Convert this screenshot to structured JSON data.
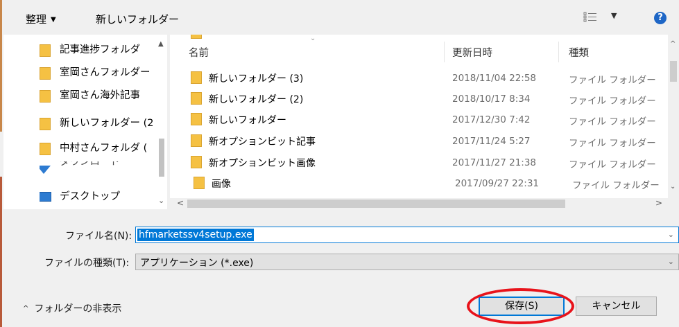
{
  "toolbar": {
    "organize_label": "整理",
    "new_folder_label": "新しいフォルダー",
    "help_label": "?"
  },
  "nav": {
    "items": [
      {
        "label": "記事進捗フォルダ",
        "icon": "folder-icon"
      },
      {
        "label": "室岡さんフォルダー",
        "icon": "folder-icon"
      },
      {
        "label": "室岡さん海外記事",
        "icon": "folder-icon"
      },
      {
        "label": "新しいフォルダー (2",
        "icon": "folder-icon"
      },
      {
        "label": "中村さんフォルダ (",
        "icon": "folder-icon"
      },
      {
        "label": "ダウンロード",
        "icon": "download-icon"
      },
      {
        "label": "デスクトップ",
        "icon": "desktop-icon"
      }
    ]
  },
  "columns": {
    "name": "名前",
    "date": "更新日時",
    "type": "種類"
  },
  "files": [
    {
      "name": "新しいフォルダー (3)",
      "date": "2018/11/04 22:58",
      "type": "ファイル フォルダー"
    },
    {
      "name": "新しいフォルダー (2)",
      "date": "2018/10/17 8:34",
      "type": "ファイル フォルダー"
    },
    {
      "name": "新しいフォルダー",
      "date": "2017/12/30 7:42",
      "type": "ファイル フォルダー"
    },
    {
      "name": "新オプションビット記事",
      "date": "2017/11/24 5:27",
      "type": "ファイル フォルダー"
    },
    {
      "name": "新オプションビット画像",
      "date": "2017/11/27 21:38",
      "type": "ファイル フォルダー"
    },
    {
      "name": "画像",
      "date": "2017/09/27 22:31",
      "type": "ファイル フォルダー"
    }
  ],
  "form": {
    "filename_label": "ファイル名(N):",
    "filename_value": "hfmarketssv4setup.exe",
    "filetype_label": "ファイルの種類(T):",
    "filetype_value": "アプリケーション (*.exe)"
  },
  "footer": {
    "hide_folders_label": "フォルダーの非表示",
    "save_label": "保存(S)",
    "cancel_label": "キャンセル"
  },
  "colors": {
    "accent": "#0078d7",
    "annotation_ring": "#e8131b",
    "folder": "#f5c143"
  }
}
